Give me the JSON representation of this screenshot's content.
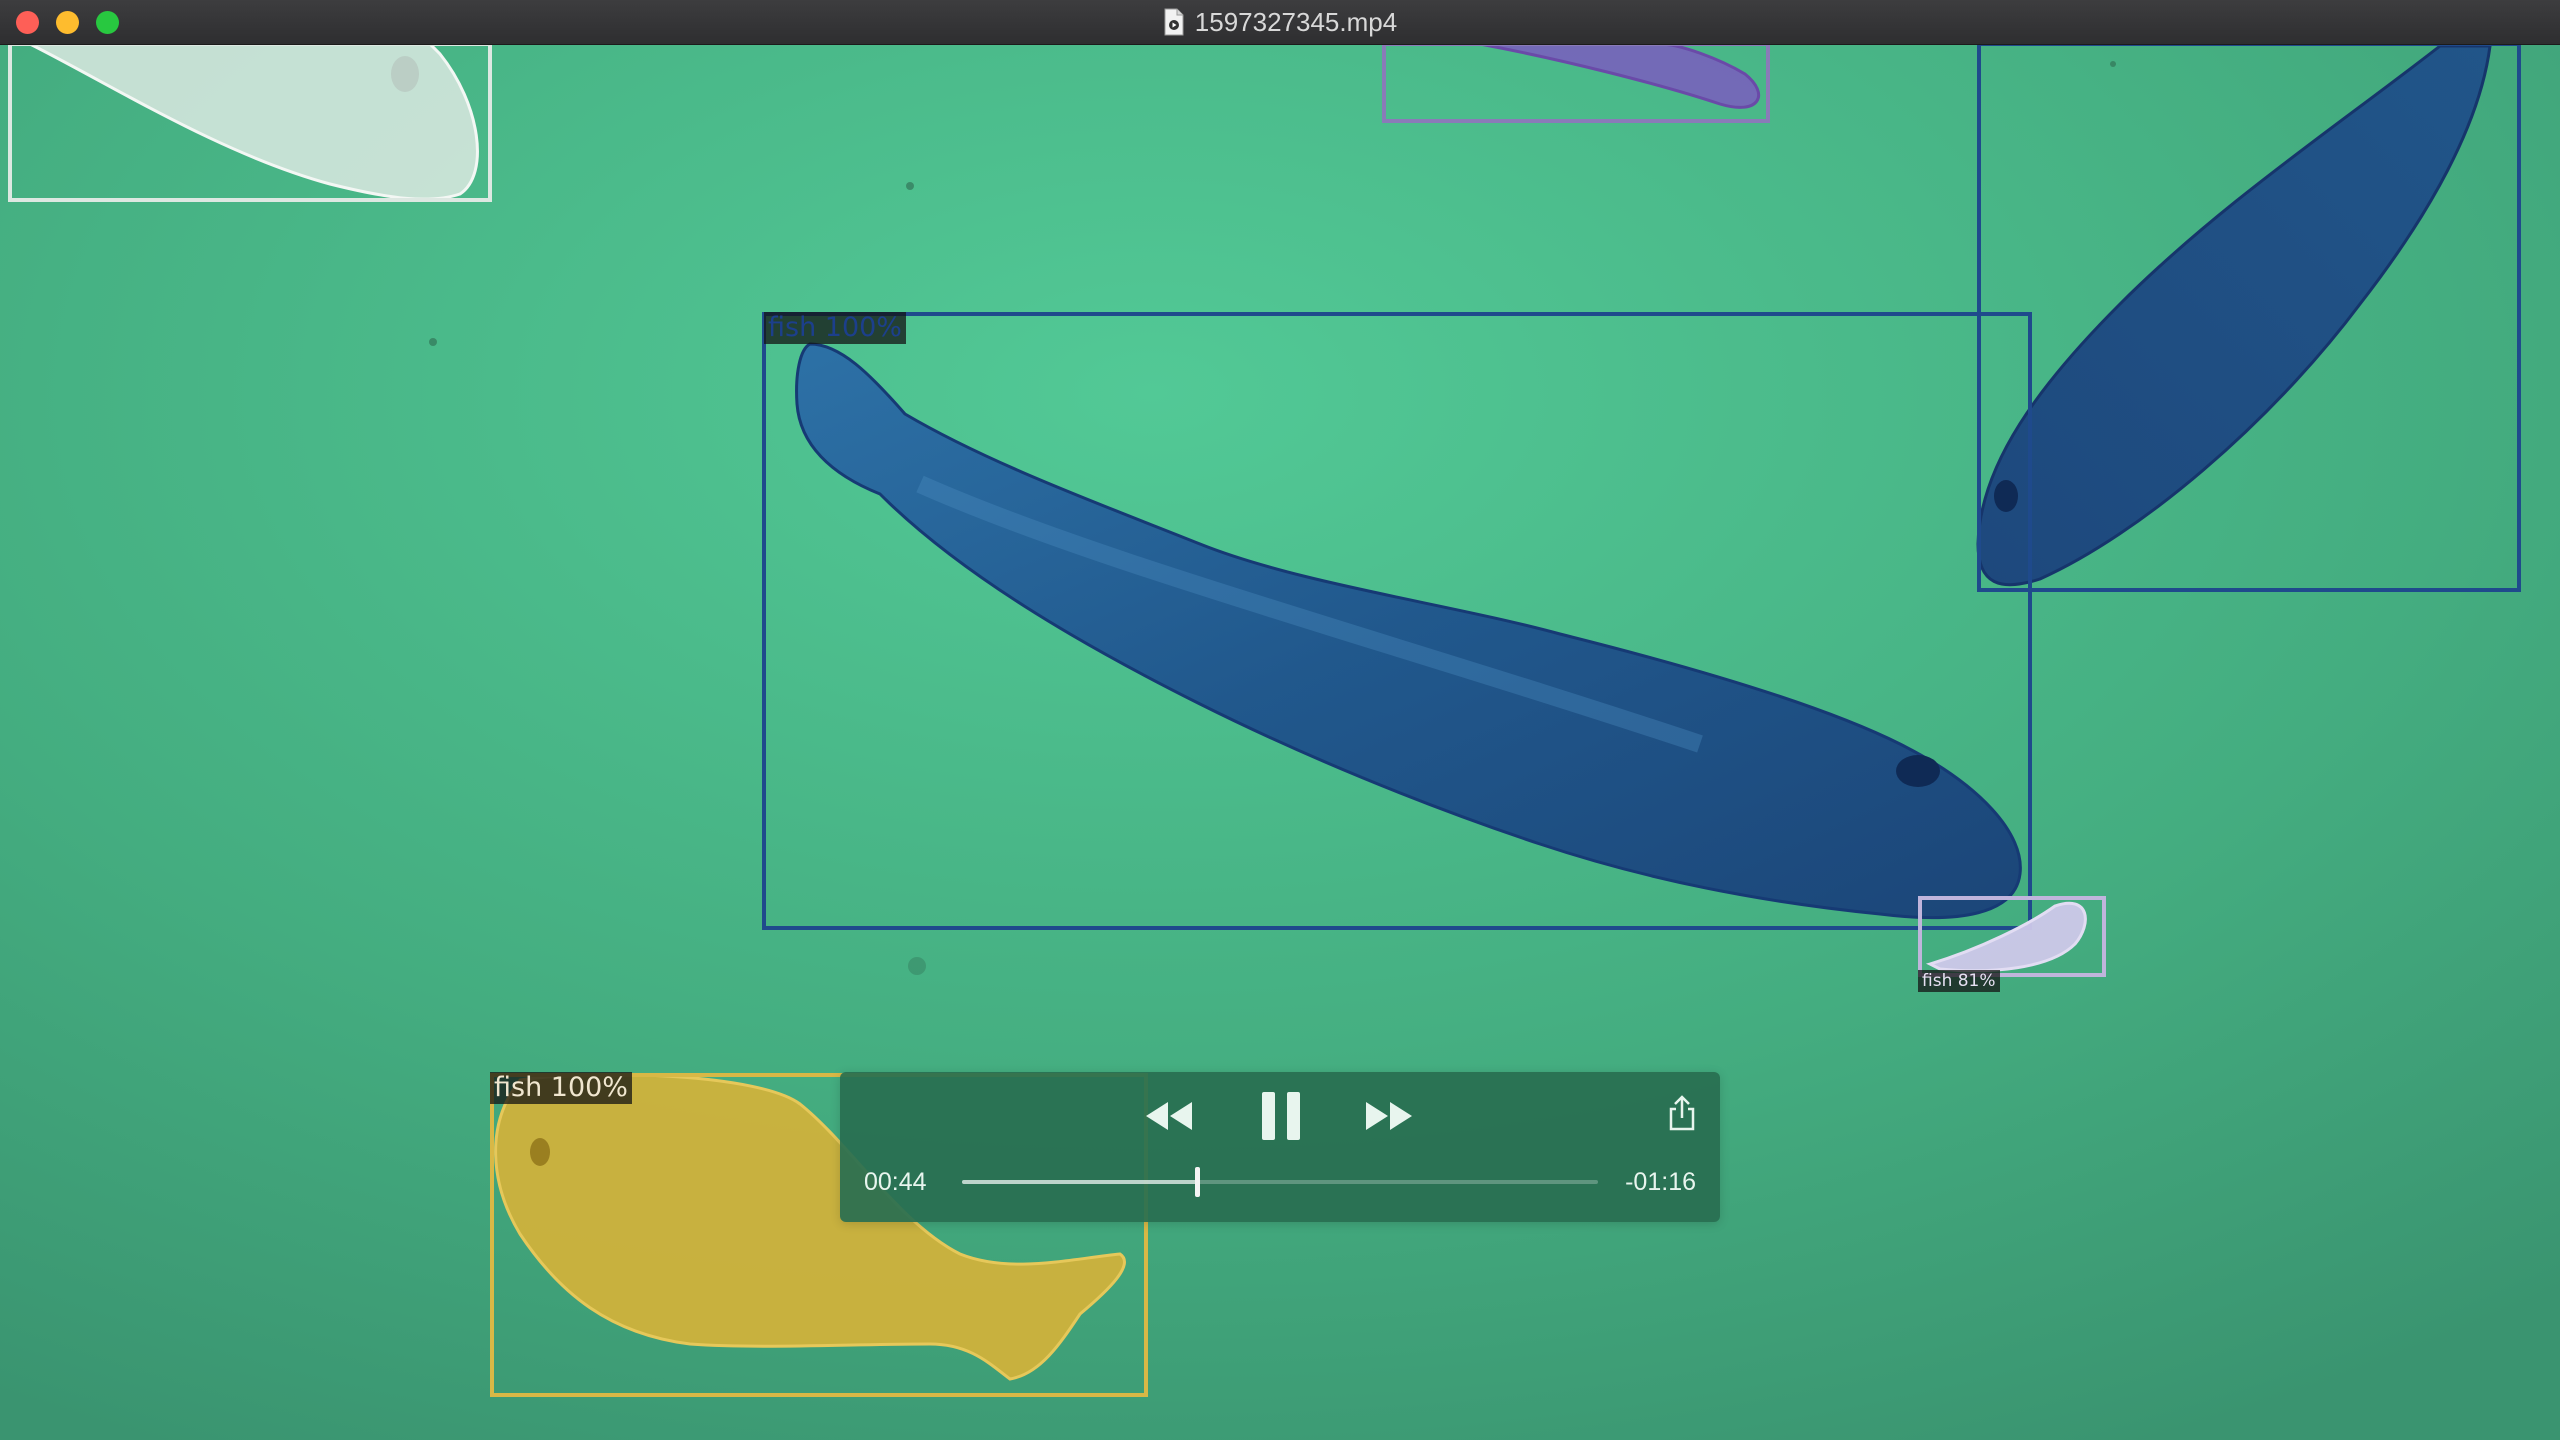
{
  "window": {
    "title": "1597327345.mp4"
  },
  "detections": [
    {
      "label": "fish 100%",
      "color": "#1c3f8c"
    },
    {
      "label": "fish 100%",
      "color": "#d4b23a"
    },
    {
      "label": "fish 81%",
      "color": "#c9c0e0"
    }
  ],
  "player": {
    "elapsed": "00:44",
    "remaining": "-01:16",
    "progress": 0.37,
    "rewind_icon": "rewind-icon",
    "pause_icon": "pause-icon",
    "forward_icon": "fast-forward-icon",
    "share_icon": "share-icon"
  },
  "colors": {
    "water": "#3f9a72",
    "controls_bg": "#286e50",
    "accent_text": "#e8f5ee"
  }
}
